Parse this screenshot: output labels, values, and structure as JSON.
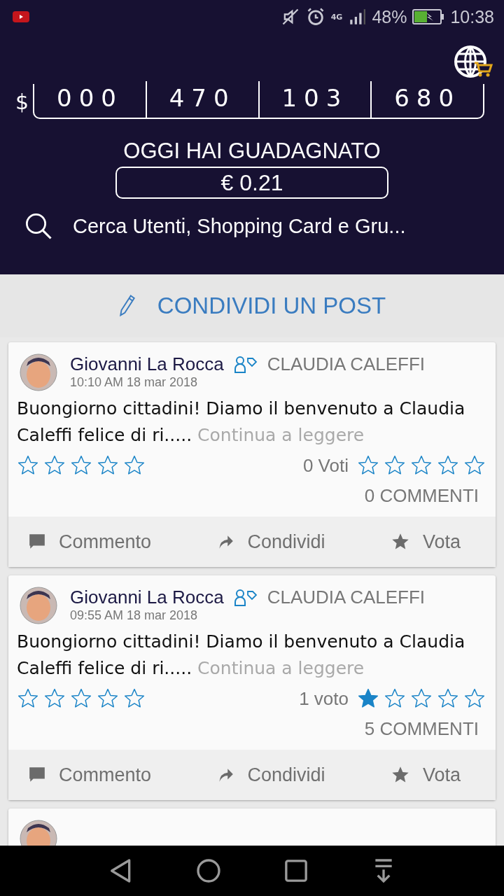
{
  "status_bar": {
    "battery": "48%",
    "time": "10:38",
    "network": "4G"
  },
  "counter": {
    "currency": "$",
    "groups": [
      "000",
      "470",
      "103",
      "680"
    ]
  },
  "earnings": {
    "label": "OGGI HAI GUADAGNATO",
    "value": "€ 0.21"
  },
  "search": {
    "placeholder": "Cerca Utenti, Shopping Card e Gru..."
  },
  "share_bar": {
    "label": "CONDIVIDI UN POST"
  },
  "posts": [
    {
      "author": "Giovanni La Rocca",
      "group": "CLAUDIA CALEFFI",
      "time": "10:10 AM 18 mar 2018",
      "text": "Buongiorno cittadini! Diamo il benvenuto a Claudia Caleffi felice di ri.....",
      "more": "Continua a leggere",
      "user_rating": {
        "stars": 0
      },
      "rating": {
        "votes": "0 Voti",
        "stars": 0
      },
      "comments": "0 COMMENTI",
      "actions": [
        "Commento",
        "Condividi",
        "Vota"
      ]
    },
    {
      "author": "Giovanni La Rocca",
      "group": "CLAUDIA CALEFFI",
      "time": "09:55 AM 18 mar 2018",
      "text": "Buongiorno cittadini! Diamo il benvenuto a Claudia Caleffi felice di ri.....",
      "more": "Continua a leggere",
      "user_rating": {
        "stars": 0
      },
      "rating": {
        "votes": "1 voto",
        "stars": 1
      },
      "comments": "5 COMMENTI",
      "actions": [
        "Commento",
        "Condividi",
        "Vota"
      ]
    }
  ]
}
